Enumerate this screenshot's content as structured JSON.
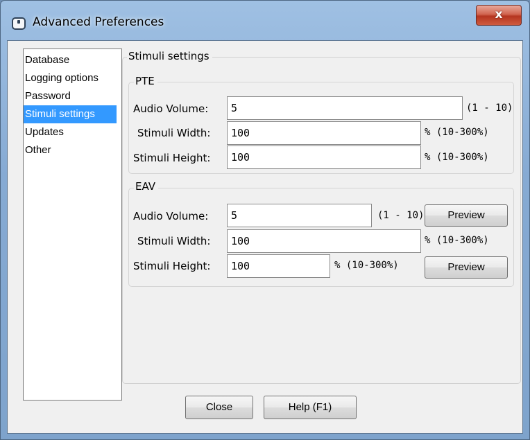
{
  "window": {
    "title": "Advanced Preferences",
    "close_glyph": "x",
    "icon": "app-window-icon"
  },
  "nav": {
    "items": [
      "Database",
      "Logging options",
      "Password",
      "Stimuli settings",
      "Updates",
      "Other"
    ],
    "selected": "Stimuli settings"
  },
  "panel": {
    "title": "Stimuli settings",
    "pte": {
      "title": "PTE",
      "audio_volume_label": "Audio Volume:",
      "audio_volume_value": "5",
      "audio_volume_range": "(1 - 10)",
      "width_label": "Stimuli Width:",
      "width_value": "100",
      "width_range": "% (10-300%)",
      "height_label": "Stimuli Height:",
      "height_value": "100",
      "height_range": "% (10-300%)"
    },
    "eav": {
      "title": "EAV",
      "audio_volume_label": "Audio Volume:",
      "audio_volume_value": "5",
      "audio_volume_range": "(1 - 10)",
      "audio_preview_label": "Preview",
      "width_label": "Stimuli Width:",
      "width_value": "100",
      "width_range": "% (10-300%)",
      "height_label": "Stimuli Height:",
      "height_value": "100",
      "height_range": "% (10-300%)",
      "height_preview_label": "Preview"
    }
  },
  "footer": {
    "close_label": "Close",
    "help_label": "Help (F1)"
  },
  "colors": {
    "selection": "#3399ff",
    "close_button": "#c8452c",
    "frame": "#86aad3"
  }
}
